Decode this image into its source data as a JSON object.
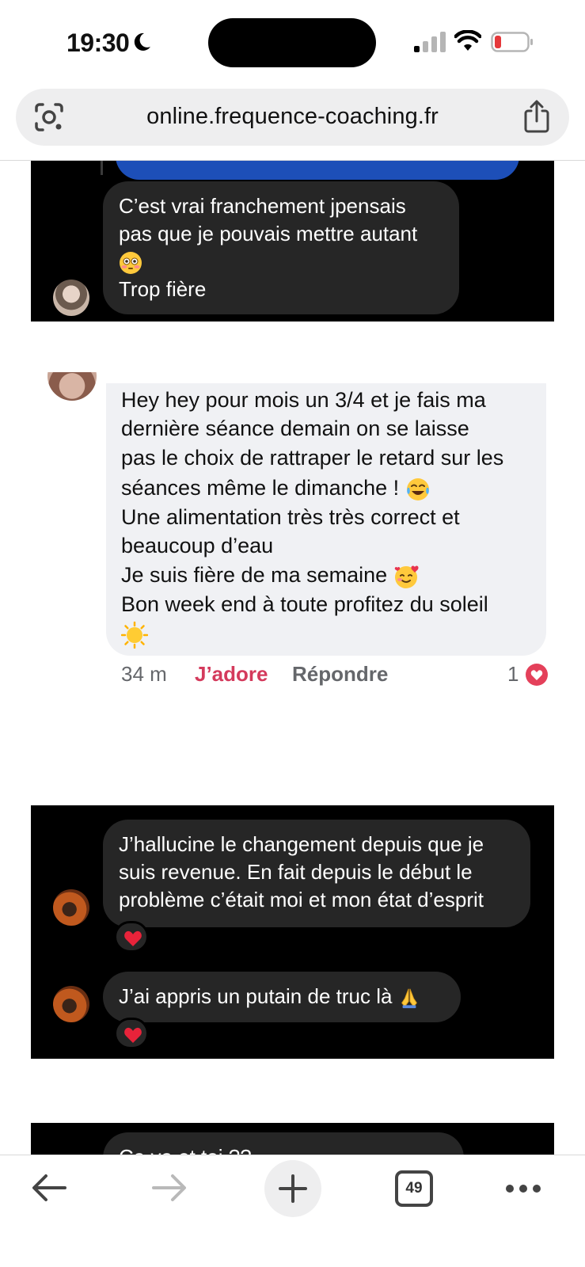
{
  "status_bar": {
    "time": "19:30"
  },
  "browser": {
    "url": "online.frequence-coaching.fr",
    "tab_count": "49"
  },
  "panel_top": {
    "message_lines": [
      "C’est vrai franchement jpensais",
      "pas que je pouvais mettre autant",
      "Trop fière"
    ],
    "emoji": "flushed-face"
  },
  "comment": {
    "lines": [
      "Hey hey pour mois un 3/4 et je fais ma",
      "dernière séance demain on se laisse",
      "pas le choix de rattraper le retard sur les",
      "séances même le dimanche !",
      "Une alimentation très très correct et",
      "beaucoup d’eau",
      "Je suis fière de ma semaine",
      "Bon week end à toute profitez du soleil"
    ],
    "time": "34 m",
    "like_label": "J’adore",
    "reply_label": "Répondre",
    "reaction_count": "1"
  },
  "panel_middle": {
    "message_1_lines": [
      "J’hallucine le changement depuis que je",
      "suis revenue. En fait depuis le début le",
      "problème c’était moi et mon état d’esprit"
    ],
    "message_2": "J’ai appris un putain de truc là"
  },
  "panel_bottom": {
    "partial_message": "Ça va et toi ??"
  },
  "colors": {
    "accent_like": "#d43a5c",
    "heart": "#e4405a",
    "panel_bg": "#000000",
    "dark_bubble": "#262626",
    "light_bubble": "#f0f1f4"
  },
  "icons": [
    "moon-icon",
    "cellular-signal-icon",
    "wifi-icon",
    "battery-low-icon",
    "google-lens-icon",
    "share-icon",
    "back-arrow-icon",
    "forward-arrow-icon",
    "new-tab-plus-icon",
    "tabs-count-icon",
    "more-dots-icon"
  ]
}
